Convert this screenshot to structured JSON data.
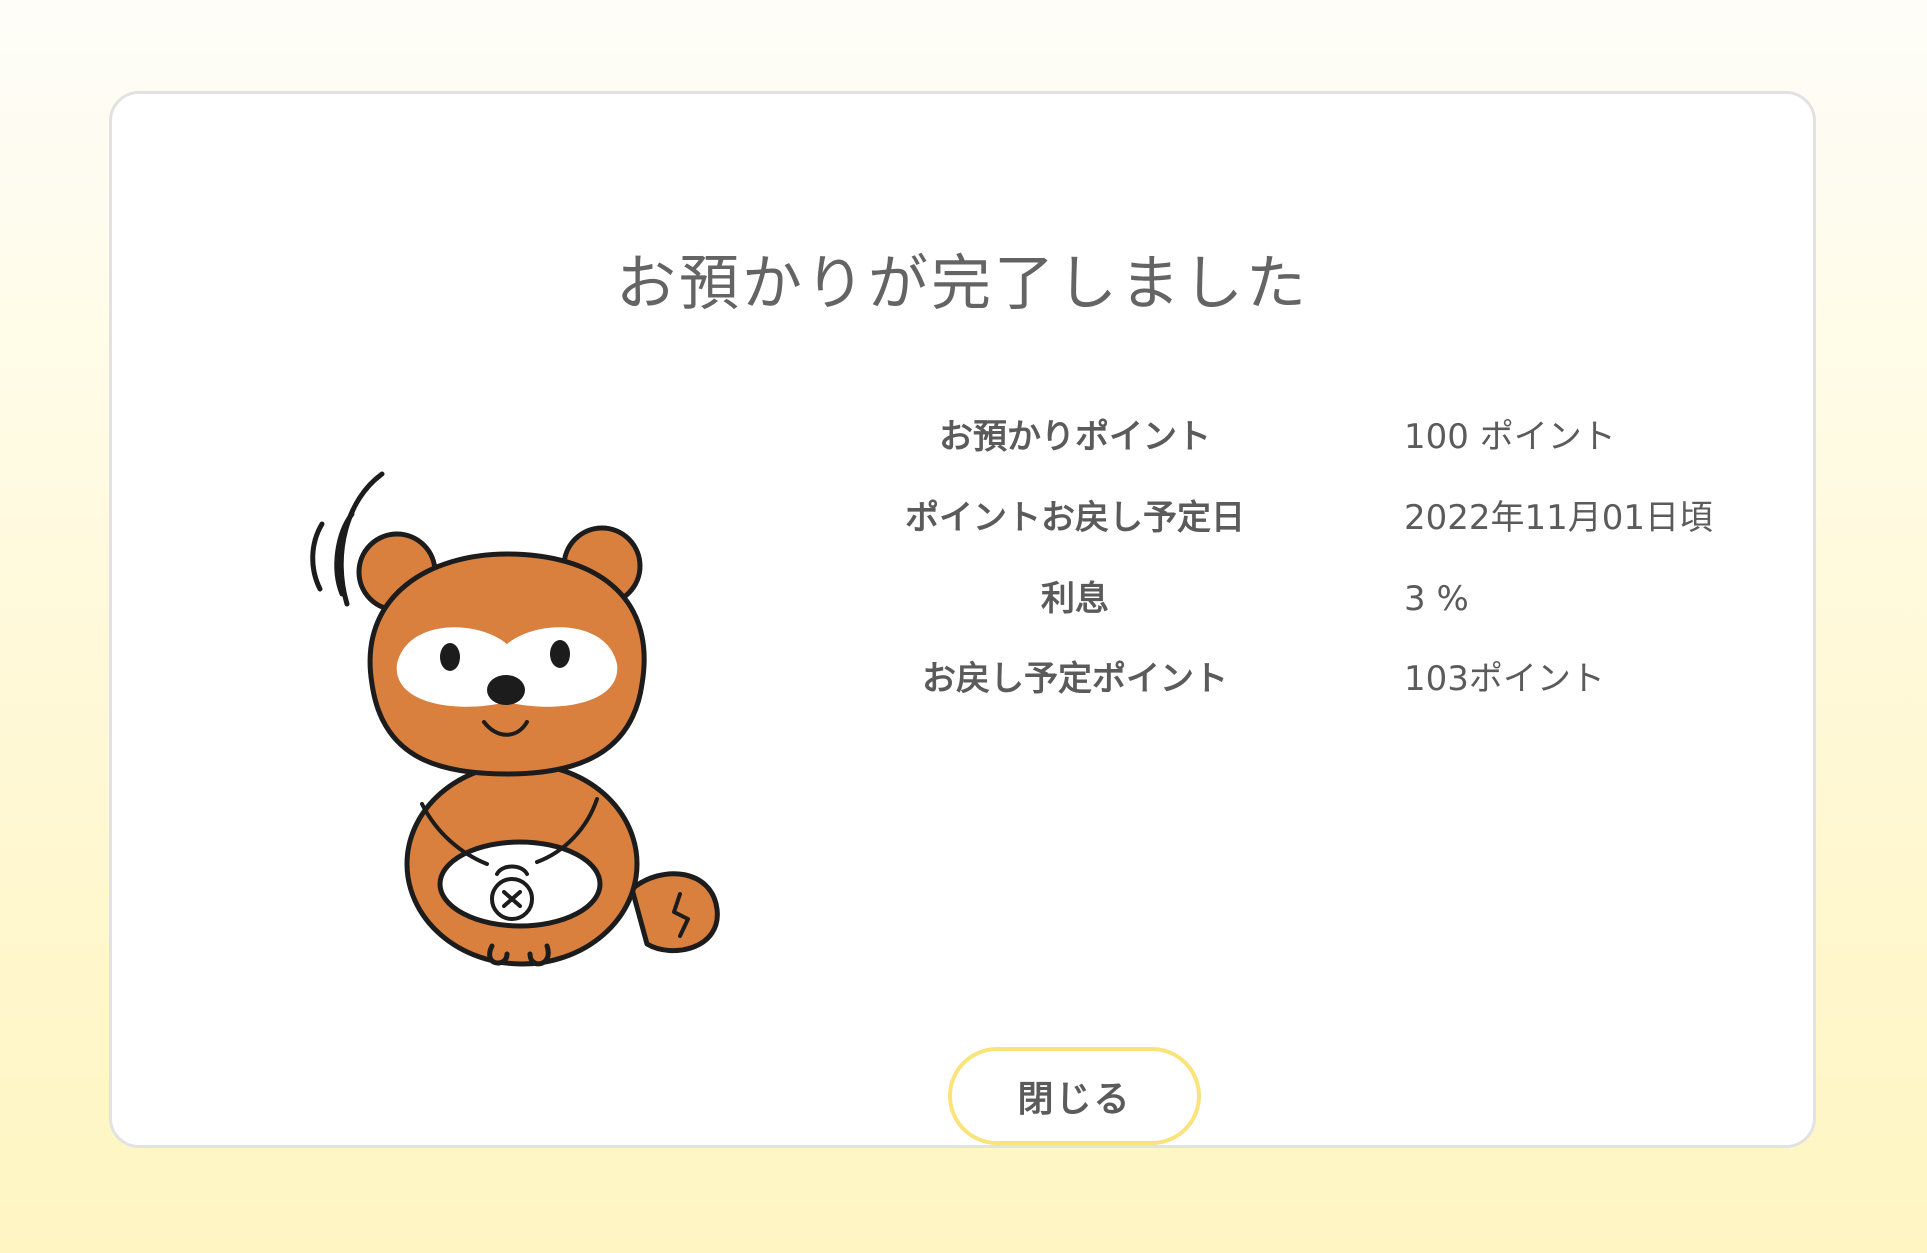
{
  "dialog": {
    "title": "お預かりが完了しました",
    "rows": [
      {
        "label": "お預かりポイント",
        "value": "100 ポイント"
      },
      {
        "label": "ポイントお戻し予定日",
        "value": "2022年11月01日頃"
      },
      {
        "label": "利息",
        "value": "3 %"
      },
      {
        "label": "お戻し予定ポイント",
        "value": "103ポイント"
      }
    ],
    "close_label": "閉じる"
  },
  "mascot": {
    "icon": "tanuki-mascot-illustration"
  },
  "colors": {
    "button_border": "#f9e37a",
    "text": "#5b5b5b",
    "mascot_fur": "#d9803f",
    "background": "#fff7cf"
  }
}
